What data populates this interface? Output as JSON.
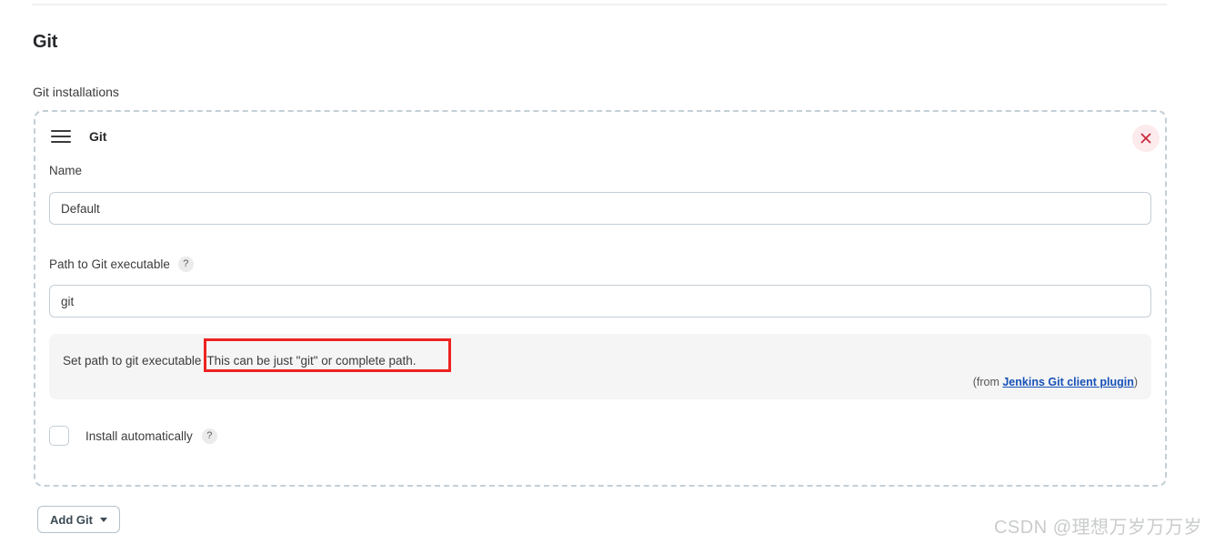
{
  "page": {
    "title": "Git",
    "section_label": "Git installations"
  },
  "installation": {
    "drag_handle_icon": "drag-handle-icon",
    "header_title": "Git",
    "close_icon": "close-icon",
    "name_field": {
      "label": "Name",
      "value": "Default",
      "placeholder": "Default"
    },
    "path_field": {
      "label": "Path to Git executable",
      "help_badge": "?",
      "value": "git",
      "placeholder": "git"
    },
    "help_panel": {
      "text_before_highlight": "Set path to git executable",
      "highlighted_text": "This can be just \"git\" or complete path.",
      "credit_prefix": "(from ",
      "credit_link": "Jenkins Git client plugin",
      "credit_suffix": ")"
    },
    "install_automatically": {
      "label": "Install automatically",
      "help_badge": "?",
      "checked": false
    }
  },
  "actions": {
    "add_button_label": "Add Git",
    "add_button_caret": "chevron-down-icon"
  },
  "watermark": {
    "text": "CSDN @理想万岁万万岁"
  },
  "colors": {
    "accent_link": "#1651b7",
    "highlight_red": "#ee2222",
    "close_red": "#c9293c",
    "dashed_border": "#c4cfd6",
    "help_panel_bg": "#f5f5f5"
  }
}
